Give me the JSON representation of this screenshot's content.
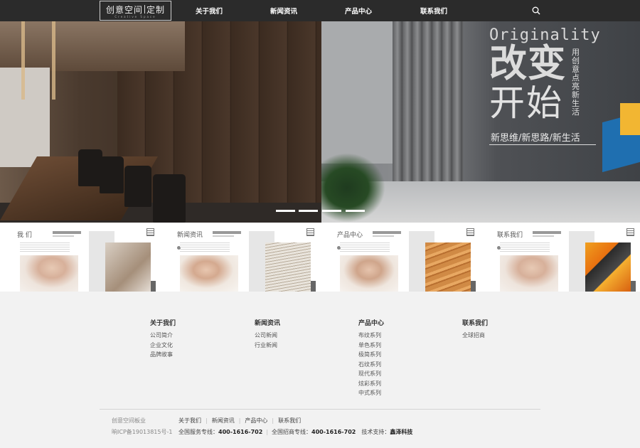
{
  "logo": {
    "main_part1": "创意空间",
    "main_part2": "定制",
    "subtitle": "Creative Space"
  },
  "nav": [
    {
      "label": "关于我们"
    },
    {
      "label": "新闻资讯"
    },
    {
      "label": "产品中心"
    },
    {
      "label": "联系我们"
    }
  ],
  "search_icon": "search-icon",
  "banner": {
    "originality": "Originality",
    "headline1": "改变",
    "headline2": "开始",
    "vertical_text": "用创意点亮新生活",
    "subtitle": "新思维/新思路/新生活",
    "slide_count": 4,
    "active_slide": 1
  },
  "cards": [
    {
      "title": "我 们"
    },
    {
      "title": "新闻资讯"
    },
    {
      "title": "产品中心"
    },
    {
      "title": "联系我们"
    }
  ],
  "footer": {
    "columns": [
      {
        "heading": "关于我们",
        "links": [
          "公司简介",
          "企业文化",
          "品牌故事"
        ]
      },
      {
        "heading": "新闻资讯",
        "links": [
          "公司新闻",
          "行业新闻"
        ]
      },
      {
        "heading": "产品中心",
        "links": [
          "布纹系列",
          "单色系列",
          "极简系列",
          "石纹系列",
          "现代系列",
          "炫彩系列",
          "中式系列"
        ]
      },
      {
        "heading": "联系我们",
        "links": [
          "全球招商"
        ]
      }
    ],
    "brand": "创意空间板业",
    "icp": "晌ICP备19013815号-1",
    "bottom_links": [
      "关于我们",
      "新闻资讯",
      "产品中心",
      "联系我们"
    ],
    "service_label": "全国服务专线：",
    "service_phone": "400-1616-702",
    "invest_label": "全国招商专线：",
    "invest_phone": "400-1616-702",
    "tech_label": "技术支持：",
    "tech_company": "鑫泽科技"
  },
  "colors": {
    "header_bg": "#2b2b2b",
    "footer_bg": "#f2f2f2",
    "accent_blue": "#1f6fb0"
  }
}
